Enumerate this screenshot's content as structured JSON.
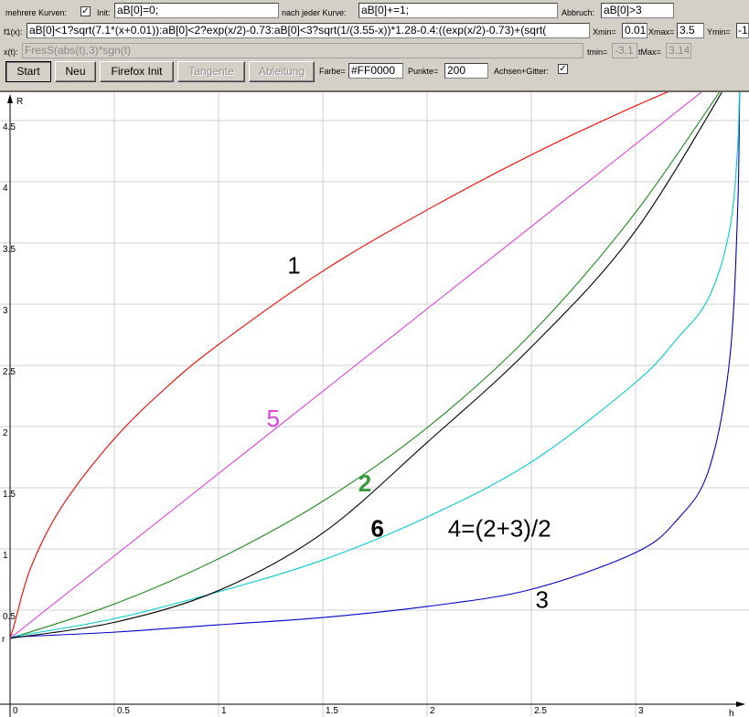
{
  "toolbar": {
    "multi_label": "mehrere Kurven:",
    "multi_checked": "✓",
    "init_label": "Init:",
    "init_value": "aB[0]=0;",
    "after_label": "nach jeder Kurve:",
    "after_value": "aB[0]+=1;",
    "abort_label": "Abbruch:",
    "abort_value": "aB[0]>3",
    "f1_label": "f1(x):",
    "f1_value": "aB[0]<1?sqrt(7.1*(x+0.01)):aB[0]<2?exp(x/2)-0.73:aB[0]<3?sqrt(1/(3.55-x))*1.28-0.4:((exp(x/2)-0.73)+(sqrt(",
    "xmin_label": "Xmin=",
    "xmin_value": "0.01",
    "xmax_label": "Xmax=",
    "xmax_value": "3.5",
    "ymin_label": "Ymin=",
    "ymin_value": "-1",
    "xt_label": "x(t):",
    "xt_value": "FresS(abs(t),3)*sgn(t)",
    "tmin_label": "tmin=",
    "tmin_value": "-3.1",
    "tmax_label": "tMax=",
    "tmax_value": "3.14",
    "start_button": "Start",
    "new_button": "Neu",
    "firefox_button": "Firefox Init",
    "tangent_button": "Tangente",
    "derivative_button": "Ableitung",
    "color_label": "Farbe=",
    "color_value": "#FF0000",
    "points_label": "Punkte=",
    "points_value": "200",
    "axes_label": "Achsen+Gitter:",
    "axes_checked": "✓"
  },
  "chart_data": {
    "type": "line",
    "xlabel": "h",
    "ylabel": "R",
    "origin_y_label": "r",
    "xlim": [
      0,
      3.5
    ],
    "ylim": [
      0.3,
      4.9
    ],
    "x_ticks": [
      0,
      0.5,
      1,
      1.5,
      2,
      2.5,
      3
    ],
    "x_tick_labels": [
      "0",
      "0.5",
      "1",
      "1.5",
      "2",
      "2.5",
      "3"
    ],
    "y_ticks": [
      0.5,
      1,
      1.5,
      2,
      2.5,
      3,
      3.5,
      4,
      4.5
    ],
    "y_tick_labels": [
      "0.5",
      "1",
      "1.5",
      "2",
      "2.5",
      "3",
      "3.5",
      "4",
      "4.5"
    ],
    "grid": true,
    "series": [
      {
        "name": "1",
        "color": "#ff0000",
        "x": [
          0,
          0.02,
          0.1,
          0.25,
          0.5,
          0.75,
          1,
          1.5,
          2,
          2.5,
          3,
          3.5
        ],
        "y": [
          0.27,
          0.38,
          0.85,
          1.35,
          1.9,
          2.32,
          2.67,
          3.27,
          3.77,
          4.22,
          4.62,
          4.98
        ]
      },
      {
        "name": "2",
        "color": "#228b22",
        "x": [
          0,
          0.5,
          1,
          1.5,
          2,
          2.5,
          3,
          3.5
        ],
        "y": [
          0.27,
          0.55,
          0.92,
          1.39,
          1.99,
          2.76,
          3.75,
          4.98
        ]
      },
      {
        "name": "3",
        "color": "#0000cd",
        "x": [
          0,
          0.5,
          1,
          1.5,
          2,
          2.5,
          3,
          3.2,
          3.35,
          3.45,
          3.49,
          3.5
        ],
        "y": [
          0.28,
          0.32,
          0.38,
          0.44,
          0.53,
          0.67,
          0.97,
          1.24,
          1.64,
          2.53,
          3.8,
          4.98
        ]
      },
      {
        "name": "4=(2+3)/2",
        "color": "#00cccc",
        "x": [
          0,
          0.5,
          1,
          1.5,
          2,
          2.5,
          3,
          3.2,
          3.35,
          3.45,
          3.49,
          3.5
        ],
        "y": [
          0.28,
          0.43,
          0.65,
          0.91,
          1.26,
          1.71,
          2.36,
          2.72,
          3.05,
          3.6,
          4.3,
          4.98
        ]
      },
      {
        "name": "5",
        "color": "#dd44dd",
        "x": [
          0,
          3.5
        ],
        "y": [
          0.27,
          4.98
        ]
      },
      {
        "name": "6",
        "color": "#000000",
        "x": [
          0,
          0.5,
          1,
          1.5,
          2,
          2.5,
          3,
          3.5
        ],
        "y": [
          0.27,
          0.4,
          0.66,
          1.13,
          1.87,
          2.65,
          3.6,
          4.98
        ]
      }
    ],
    "curve_labels": [
      {
        "text": "1",
        "x": 1.33,
        "y": 3.25,
        "color": "#000000"
      },
      {
        "text": "5",
        "x": 1.23,
        "y": 2.0,
        "color": "#dd44dd"
      },
      {
        "text": "2",
        "x": 1.67,
        "y": 1.47,
        "color": "#3a9a3a"
      },
      {
        "text": "6",
        "x": 1.73,
        "y": 1.1,
        "color": "#000000"
      },
      {
        "text": "4=(2+3)/2",
        "x": 2.1,
        "y": 1.1,
        "color": "#000000"
      },
      {
        "text": "3",
        "x": 2.52,
        "y": 0.52,
        "color": "#000000"
      }
    ]
  }
}
